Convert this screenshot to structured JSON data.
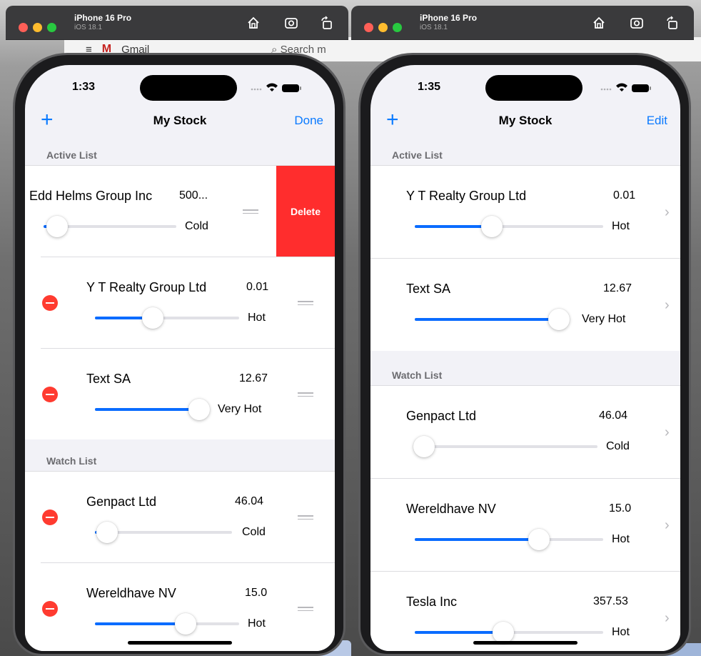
{
  "background": {
    "app": "Gmail",
    "search_placeholder": "Search m"
  },
  "left_window": {
    "device_name": "iPhone 16 Pro",
    "device_os": "iOS 18.1",
    "time": "1:33",
    "nav": {
      "title": "My Stock",
      "right_action": "Done",
      "left_icon": "plus-icon"
    },
    "sections": {
      "active_header": "Active List",
      "watch_header": "Watch List"
    },
    "swiped_row": {
      "name": "Edd Helms Group Inc",
      "price": "500...",
      "level": "Cold",
      "slider_value": 0.1,
      "delete_label": "Delete"
    },
    "active_rows": [
      {
        "name": "Y T Realty Group Ltd",
        "price": "0.01",
        "level": "Hot",
        "slider_value": 0.4
      },
      {
        "name": "Text SA",
        "price": "12.67",
        "level": "Very Hot",
        "slider_value": 1.0
      }
    ],
    "watch_rows": [
      {
        "name": "Genpact Ltd",
        "price": "46.04",
        "level": "Cold",
        "slider_value": 0.09
      },
      {
        "name": "Wereldhave NV",
        "price": "15.0",
        "level": "Hot",
        "slider_value": 0.63
      }
    ]
  },
  "right_window": {
    "device_name": "iPhone 16 Pro",
    "device_os": "iOS 18.1",
    "time": "1:35",
    "nav": {
      "title": "My Stock",
      "right_action": "Edit",
      "left_icon": "plus-icon"
    },
    "sections": {
      "active_header": "Active List",
      "watch_header": "Watch List"
    },
    "active_rows": [
      {
        "name": "Y T Realty Group Ltd",
        "price": "0.01",
        "level": "Hot",
        "slider_value": 0.41
      },
      {
        "name": "Text SA",
        "price": "12.67",
        "level": "Very Hot",
        "slider_value": 1.0
      }
    ],
    "watch_rows": [
      {
        "name": "Genpact Ltd",
        "price": "46.04",
        "level": "Cold",
        "slider_value": 0.05
      },
      {
        "name": "Wereldhave NV",
        "price": "15.0",
        "level": "Hot",
        "slider_value": 0.66
      },
      {
        "name": "Tesla Inc",
        "price": "357.53",
        "level": "Hot",
        "slider_value": 0.47
      }
    ]
  },
  "colors": {
    "accent": "#0a7aff",
    "delete": "#ff2d2d",
    "minus": "#ff3b30",
    "slider_fill": "#0a6cff"
  }
}
